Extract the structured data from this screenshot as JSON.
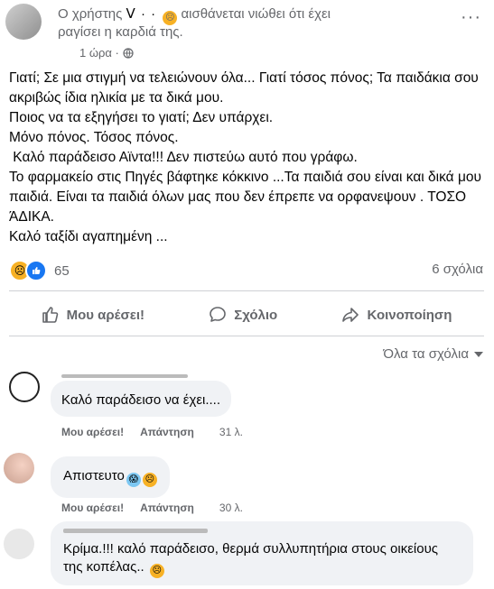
{
  "post": {
    "header_prefix": "Ο χρήστης",
    "header_name": "ꓦ ·  ·   ",
    "header_suffix": "αισθάνεται νιώθει ότι έχει",
    "header_line2": "ραγίσει η καρδιά της.",
    "time": "1 ώρα ·",
    "more": "···",
    "paragraphs": [
      "Γιατί; Σε μια στιγμή να τελειώνουν όλα... Γιατί τόσος πόνος; Τα παιδάκια σου ακριβώς ίδια ηλικία με τα δικά μου.",
      "Ποιος να τα εξηγήσει το γιατί; Δεν υπάρχει.",
      "Μόνο πόνος. Τόσος πόνος.",
      " Καλό παράδεισο Αϊντα!!! Δεν πιστεύω αυτό που γράφω.",
      "Το φαρμακείο στις Πηγές βάφτηκε κόκκινο ...Τα παιδιά σου  είναι και δικά μου παιδιά.  Είναι τα παιδιά όλων μας που δεν έπρεπε να ορφανεψουν . ΤΟΣΟ ΆΔΙΚΑ.",
      "Καλό ταξίδι αγαπημένη ..."
    ],
    "reactions_count": "65",
    "comments_count": "6 σχόλια",
    "actions": {
      "like": "Μου αρέσει!",
      "comment": "Σχόλιο",
      "share": "Κοινοποίηση"
    },
    "sort_label": "Όλα τα σχόλια"
  },
  "comments": [
    {
      "text": "Καλό παράδεισο να έχει....",
      "like": "Μου αρέσει!",
      "reply": "Απάντηση",
      "time": "31 λ."
    },
    {
      "text": "Απιστευτο",
      "like": "Μου αρέσει!",
      "reply": "Απάντηση",
      "time": "30 λ."
    },
    {
      "text": "Κρίμα.!!! καλό παράδεισο, θερμά συλλυπητήρια στους οικείους της κοπέλας.."
    }
  ],
  "icons": {
    "header_emoji": "sad-face-icon",
    "like": "thumbs-up-icon",
    "comment": "speech-bubble-icon",
    "share": "share-arrow-icon",
    "sort": "caret-down-icon"
  }
}
